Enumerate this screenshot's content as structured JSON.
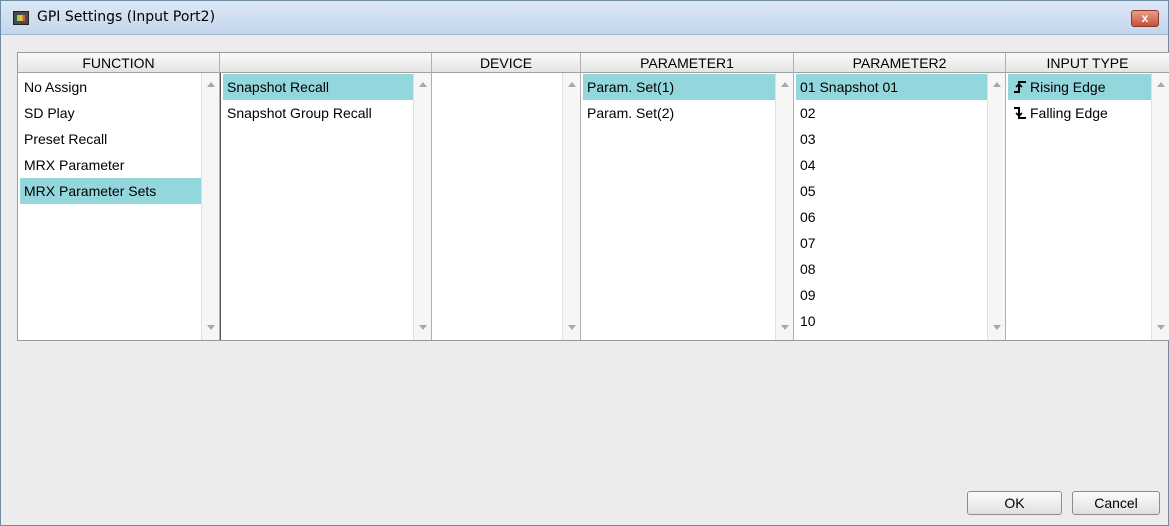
{
  "window": {
    "title": "GPI Settings (Input Port2)",
    "close_glyph": "x"
  },
  "columns": {
    "function": {
      "header": "FUNCTION",
      "items": [
        "No Assign",
        "SD Play",
        "Preset Recall",
        "MRX Parameter",
        "MRX Parameter Sets"
      ],
      "selected": "MRX Parameter Sets"
    },
    "subfunction": {
      "header": "",
      "items": [
        "Snapshot Recall",
        "Snapshot Group Recall"
      ],
      "selected": "Snapshot Recall"
    },
    "device": {
      "header": "DEVICE",
      "items": []
    },
    "parameter1": {
      "header": "PARAMETER1",
      "items": [
        "Param. Set(1)",
        "Param. Set(2)"
      ],
      "selected": "Param. Set(1)"
    },
    "parameter2": {
      "header": "PARAMETER2",
      "items": [
        "01 Snapshot 01",
        "02",
        "03",
        "04",
        "05",
        "06",
        "07",
        "08",
        "09",
        "10"
      ],
      "selected": "01 Snapshot 01"
    },
    "input_type": {
      "header": "INPUT TYPE",
      "items": [
        {
          "label": "Rising Edge",
          "icon": "rising-edge-icon"
        },
        {
          "label": "Falling Edge",
          "icon": "falling-edge-icon"
        }
      ],
      "selected": "Rising Edge"
    }
  },
  "buttons": {
    "ok": "OK",
    "cancel": "Cancel"
  },
  "colors": {
    "selection": "#93d7dc",
    "background": "#ececec"
  }
}
